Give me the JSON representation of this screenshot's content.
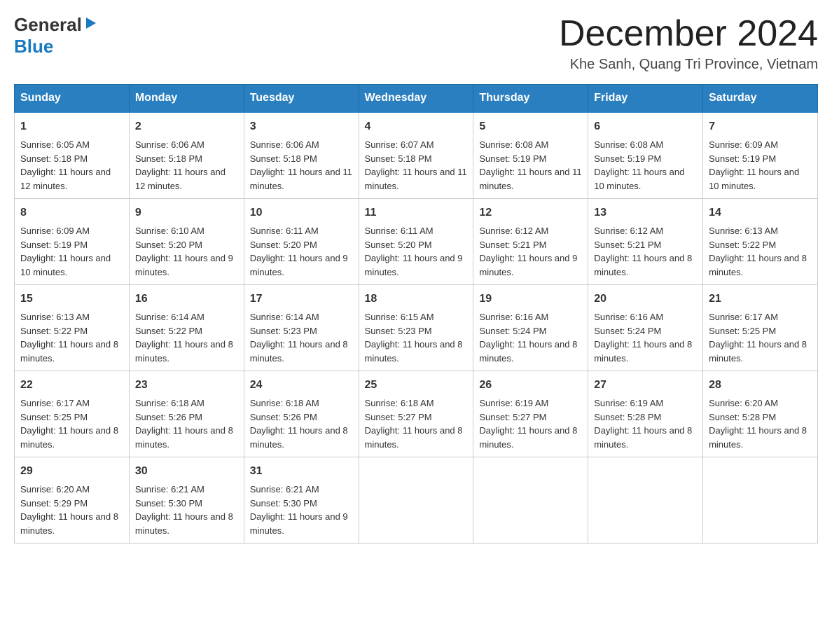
{
  "header": {
    "logo_general": "General",
    "logo_blue": "Blue",
    "month_title": "December 2024",
    "location": "Khe Sanh, Quang Tri Province, Vietnam"
  },
  "days_of_week": [
    "Sunday",
    "Monday",
    "Tuesday",
    "Wednesday",
    "Thursday",
    "Friday",
    "Saturday"
  ],
  "weeks": [
    [
      {
        "day": "1",
        "sunrise": "6:05 AM",
        "sunset": "5:18 PM",
        "daylight": "11 hours and 12 minutes."
      },
      {
        "day": "2",
        "sunrise": "6:06 AM",
        "sunset": "5:18 PM",
        "daylight": "11 hours and 12 minutes."
      },
      {
        "day": "3",
        "sunrise": "6:06 AM",
        "sunset": "5:18 PM",
        "daylight": "11 hours and 11 minutes."
      },
      {
        "day": "4",
        "sunrise": "6:07 AM",
        "sunset": "5:18 PM",
        "daylight": "11 hours and 11 minutes."
      },
      {
        "day": "5",
        "sunrise": "6:08 AM",
        "sunset": "5:19 PM",
        "daylight": "11 hours and 11 minutes."
      },
      {
        "day": "6",
        "sunrise": "6:08 AM",
        "sunset": "5:19 PM",
        "daylight": "11 hours and 10 minutes."
      },
      {
        "day": "7",
        "sunrise": "6:09 AM",
        "sunset": "5:19 PM",
        "daylight": "11 hours and 10 minutes."
      }
    ],
    [
      {
        "day": "8",
        "sunrise": "6:09 AM",
        "sunset": "5:19 PM",
        "daylight": "11 hours and 10 minutes."
      },
      {
        "day": "9",
        "sunrise": "6:10 AM",
        "sunset": "5:20 PM",
        "daylight": "11 hours and 9 minutes."
      },
      {
        "day": "10",
        "sunrise": "6:11 AM",
        "sunset": "5:20 PM",
        "daylight": "11 hours and 9 minutes."
      },
      {
        "day": "11",
        "sunrise": "6:11 AM",
        "sunset": "5:20 PM",
        "daylight": "11 hours and 9 minutes."
      },
      {
        "day": "12",
        "sunrise": "6:12 AM",
        "sunset": "5:21 PM",
        "daylight": "11 hours and 9 minutes."
      },
      {
        "day": "13",
        "sunrise": "6:12 AM",
        "sunset": "5:21 PM",
        "daylight": "11 hours and 8 minutes."
      },
      {
        "day": "14",
        "sunrise": "6:13 AM",
        "sunset": "5:22 PM",
        "daylight": "11 hours and 8 minutes."
      }
    ],
    [
      {
        "day": "15",
        "sunrise": "6:13 AM",
        "sunset": "5:22 PM",
        "daylight": "11 hours and 8 minutes."
      },
      {
        "day": "16",
        "sunrise": "6:14 AM",
        "sunset": "5:22 PM",
        "daylight": "11 hours and 8 minutes."
      },
      {
        "day": "17",
        "sunrise": "6:14 AM",
        "sunset": "5:23 PM",
        "daylight": "11 hours and 8 minutes."
      },
      {
        "day": "18",
        "sunrise": "6:15 AM",
        "sunset": "5:23 PM",
        "daylight": "11 hours and 8 minutes."
      },
      {
        "day": "19",
        "sunrise": "6:16 AM",
        "sunset": "5:24 PM",
        "daylight": "11 hours and 8 minutes."
      },
      {
        "day": "20",
        "sunrise": "6:16 AM",
        "sunset": "5:24 PM",
        "daylight": "11 hours and 8 minutes."
      },
      {
        "day": "21",
        "sunrise": "6:17 AM",
        "sunset": "5:25 PM",
        "daylight": "11 hours and 8 minutes."
      }
    ],
    [
      {
        "day": "22",
        "sunrise": "6:17 AM",
        "sunset": "5:25 PM",
        "daylight": "11 hours and 8 minutes."
      },
      {
        "day": "23",
        "sunrise": "6:18 AM",
        "sunset": "5:26 PM",
        "daylight": "11 hours and 8 minutes."
      },
      {
        "day": "24",
        "sunrise": "6:18 AM",
        "sunset": "5:26 PM",
        "daylight": "11 hours and 8 minutes."
      },
      {
        "day": "25",
        "sunrise": "6:18 AM",
        "sunset": "5:27 PM",
        "daylight": "11 hours and 8 minutes."
      },
      {
        "day": "26",
        "sunrise": "6:19 AM",
        "sunset": "5:27 PM",
        "daylight": "11 hours and 8 minutes."
      },
      {
        "day": "27",
        "sunrise": "6:19 AM",
        "sunset": "5:28 PM",
        "daylight": "11 hours and 8 minutes."
      },
      {
        "day": "28",
        "sunrise": "6:20 AM",
        "sunset": "5:28 PM",
        "daylight": "11 hours and 8 minutes."
      }
    ],
    [
      {
        "day": "29",
        "sunrise": "6:20 AM",
        "sunset": "5:29 PM",
        "daylight": "11 hours and 8 minutes."
      },
      {
        "day": "30",
        "sunrise": "6:21 AM",
        "sunset": "5:30 PM",
        "daylight": "11 hours and 8 minutes."
      },
      {
        "day": "31",
        "sunrise": "6:21 AM",
        "sunset": "5:30 PM",
        "daylight": "11 hours and 9 minutes."
      },
      null,
      null,
      null,
      null
    ]
  ],
  "labels": {
    "sunrise": "Sunrise:",
    "sunset": "Sunset:",
    "daylight": "Daylight:"
  }
}
